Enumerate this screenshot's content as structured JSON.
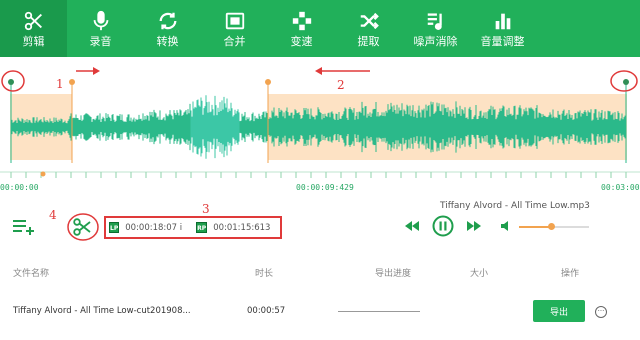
{
  "toolbar": {
    "items": [
      {
        "label": "剪辑",
        "icon": "scissors-icon",
        "active": true
      },
      {
        "label": "录音",
        "icon": "microphone-icon"
      },
      {
        "label": "转换",
        "icon": "refresh-icon"
      },
      {
        "label": "合并",
        "icon": "merge-icon"
      },
      {
        "label": "变速",
        "icon": "gamepad-icon"
      },
      {
        "label": "提取",
        "icon": "shuffle-icon"
      },
      {
        "label": "噪声消除",
        "icon": "music-note-icon"
      },
      {
        "label": "音量调整",
        "icon": "bar-chart-icon"
      }
    ],
    "bg_color": "#21b05a"
  },
  "waveform": {
    "time_start": "00:00:00",
    "time_mid": "00:00:09:429",
    "time_end": "00:03:00",
    "wave_color": "#2bb98a",
    "selection_color": "#fde2c4"
  },
  "annotations": {
    "n1": "1",
    "n2": "2",
    "n3": "3",
    "n4": "4"
  },
  "controls": {
    "song_title": "Tiffany Alvord - All Time Low.mp3",
    "lp_tag": "LP",
    "lp_time": "00:00:18:07 i",
    "rp_tag": "RP",
    "rp_time": "00:01:15:613",
    "volume_level": 0.45
  },
  "table": {
    "headers": {
      "name": "文件名称",
      "duration": "时长",
      "progress": "导出进度",
      "size": "大小",
      "action": "操作"
    },
    "rows": [
      {
        "name": "Tiffany Alvord - All Time Low-cut201908...",
        "duration": "00:00:57",
        "progress": 0,
        "size": "",
        "export_label": "导出",
        "more_label": "···"
      }
    ]
  }
}
